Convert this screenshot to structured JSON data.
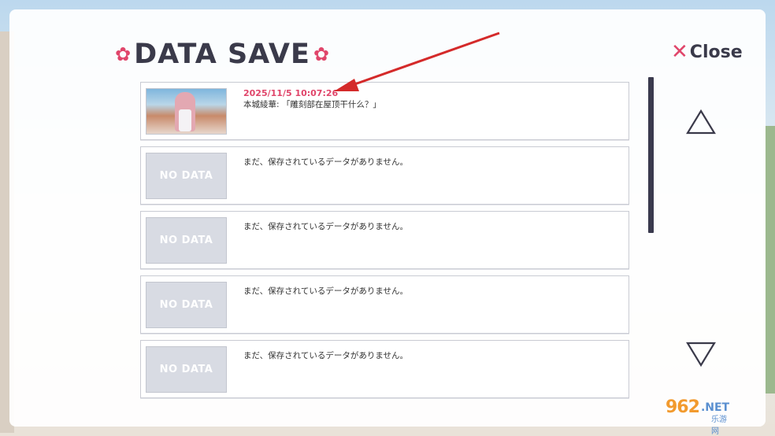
{
  "header": {
    "title": "DATA SAVE",
    "close_label": "Close"
  },
  "colors": {
    "accent": "#e0456a",
    "title": "#3a3a4a",
    "no_data_thumb": "#d8dbe3"
  },
  "slots": [
    {
      "thumb": "screenshot",
      "date": "2025/11/5 10:07:26",
      "description": "本城綾華: 「雕刻部在屋顶干什么？」"
    },
    {
      "thumb": "NO DATA",
      "description": "まだ、保存されているデータがありません。"
    },
    {
      "thumb": "NO DATA",
      "description": "まだ、保存されているデータがありません。"
    },
    {
      "thumb": "NO DATA",
      "description": "まだ、保存されているデータがありません。"
    },
    {
      "thumb": "NO DATA",
      "description": "まだ、保存されているデータがありません。"
    }
  ],
  "icons": {
    "title_decoration": "flower-icon",
    "close": "close-x-icon",
    "scroll_up": "triangle-up-icon",
    "scroll_down": "triangle-down-icon"
  },
  "watermark": {
    "number": "962",
    "suffix": ".NET",
    "cn": "乐游网"
  }
}
